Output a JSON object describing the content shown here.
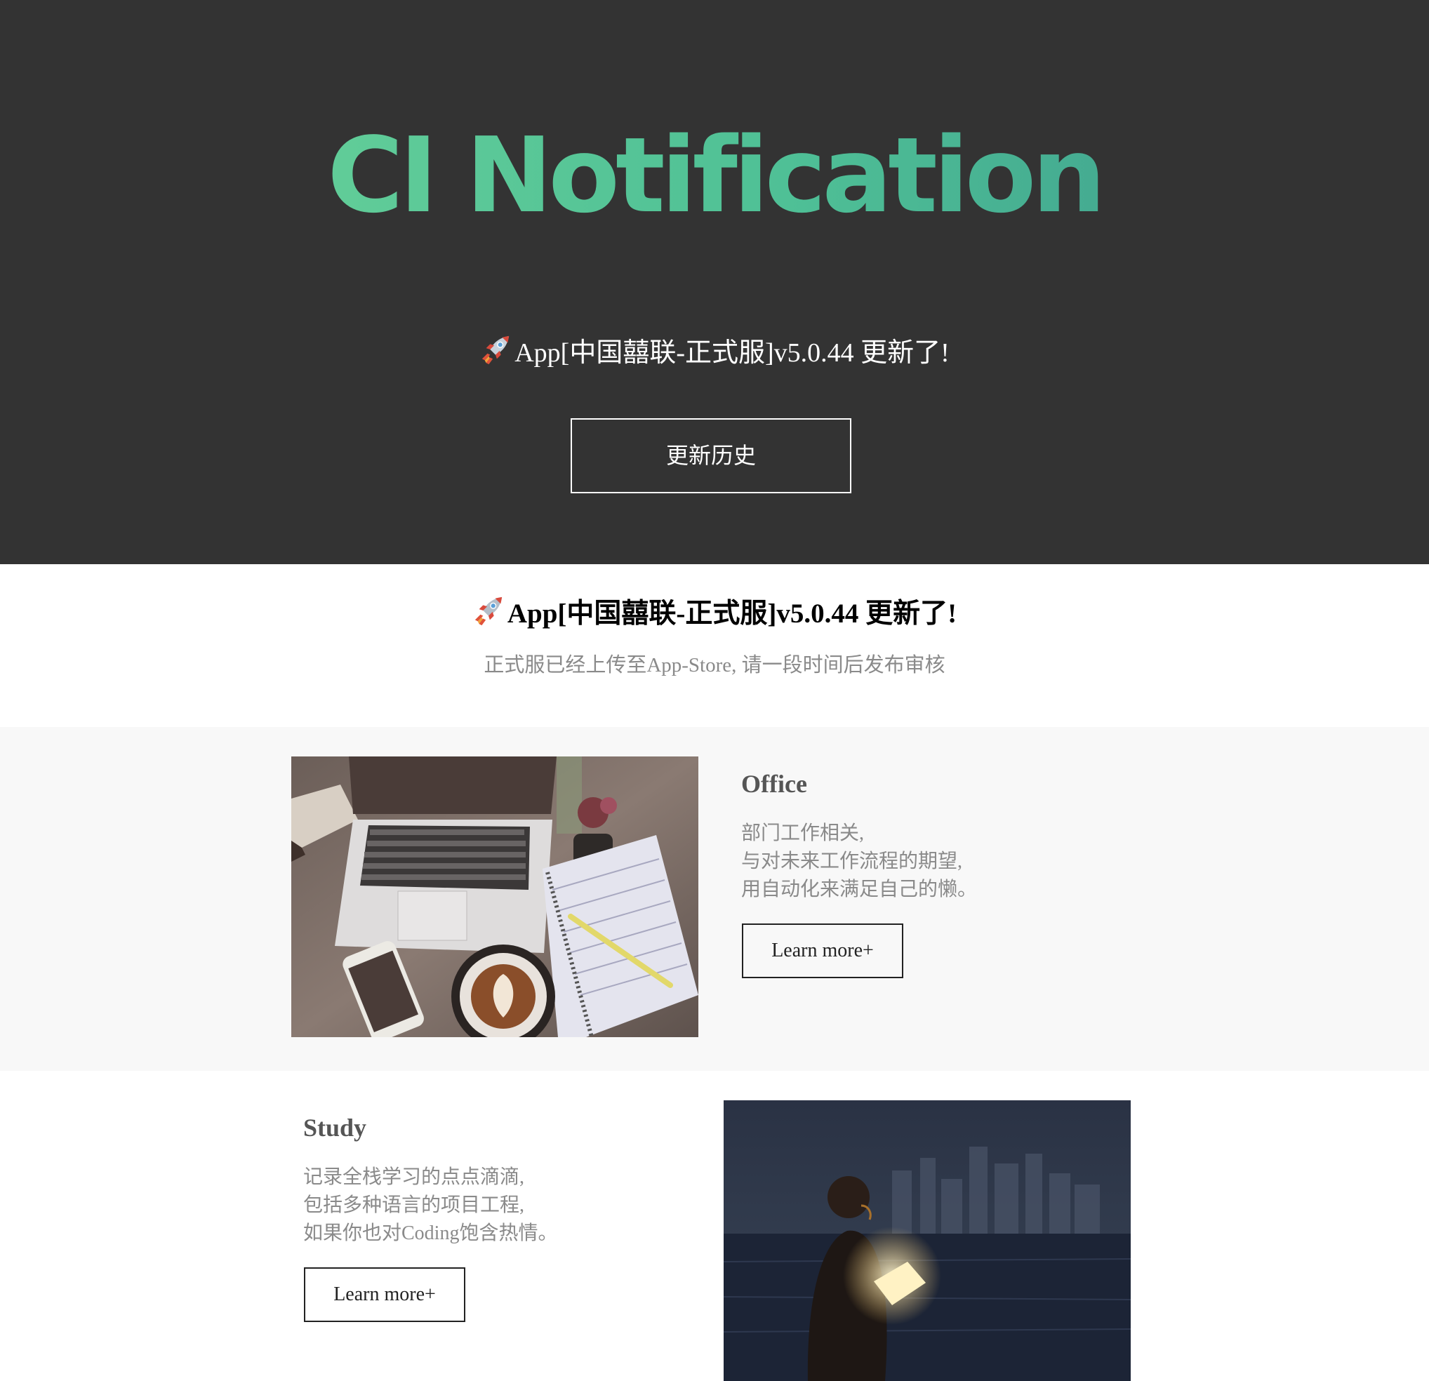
{
  "hero": {
    "title": "CI Notification",
    "subtitle": "App[中国囍联-正式服]v5.0.44 更新了!",
    "button_label": "更新历史",
    "gradient_colors": [
      "#6dd59a",
      "#3a968c"
    ],
    "background": "#333333"
  },
  "info": {
    "title": "App[中国囍联-正式服]v5.0.44 更新了!",
    "description": "正式服已经上传至App-Store, 请一段时间后发布审核"
  },
  "features": {
    "office": {
      "heading": "Office",
      "lines": [
        "部门工作相关,",
        "与对未来工作流程的期望,",
        "用自动化来满足自己的懒。"
      ],
      "button_label": "Learn more+",
      "image_icon": "laptop-desk-photo"
    },
    "study": {
      "heading": "Study",
      "lines": [
        "记录全栈学习的点点滴滴,",
        "包括多种语言的项目工程,",
        "如果你也对Coding饱含热情。"
      ],
      "button_label": "Learn more+",
      "image_icon": "man-reading-glowing-book-photo"
    }
  },
  "icons": {
    "rocket": "rocket-icon"
  }
}
